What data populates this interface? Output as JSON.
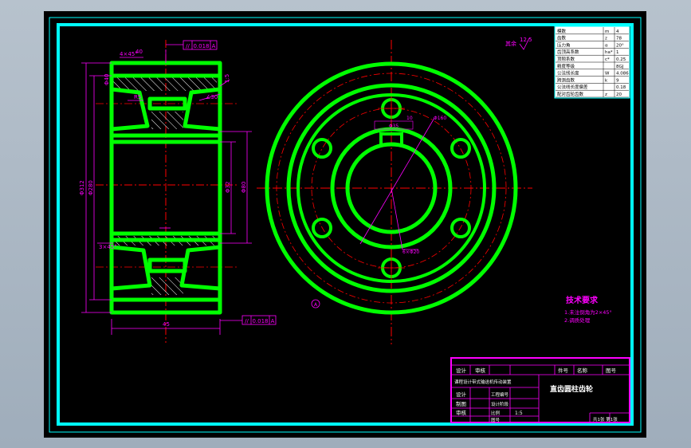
{
  "colors": {
    "background": "#000000",
    "border": "#00ffff",
    "part": "#00ff00",
    "dimension": "#ff00ff",
    "centerline": "#ff0000",
    "text": "#ffffff",
    "note": "#ff00ff"
  },
  "section_view": {
    "dims": {
      "chamfer_top": "4×45°",
      "chamfer_bottom": "3×45°",
      "outer_dia": "Φ312",
      "root_dia": "Φ280",
      "hub_dia": "Φ80",
      "bore_dia": "Φ32",
      "web_dia": "Φ40",
      "width": "45",
      "bore_width": "40",
      "fillet": "R5",
      "angle": "∠30",
      "taper": "1:5"
    },
    "tolerance_top": {
      "symbol": "//",
      "value": "0.018",
      "datum": "A"
    },
    "tolerance_bottom": {
      "symbol": "//",
      "value": "0.018",
      "datum": "A"
    }
  },
  "front_view": {
    "hole_label": "6×Φ20",
    "keyway_label": "10",
    "keyway_width": "Φ35",
    "pcd_label": "Φ160",
    "datum_label": "A",
    "roughness_note": "其余",
    "roughness_value": "12.5"
  },
  "param_table": [
    [
      "模数",
      "m",
      "4"
    ],
    [
      "齿数",
      "z",
      "78"
    ],
    [
      "压力角",
      "α",
      "20°"
    ],
    [
      "齿顶高系数",
      "ha*",
      "1"
    ],
    [
      "顶隙系数",
      "c*",
      "0.25"
    ],
    [
      "精度等级",
      "",
      "8GJ"
    ],
    [
      "公法线长度",
      "W",
      "4.086"
    ],
    [
      "跨测齿数",
      "k",
      "9"
    ],
    [
      "公法线长度偏差",
      "",
      "0.18"
    ],
    [
      "配对齿轮齿数",
      "z",
      "20"
    ]
  ],
  "technical_requirements": {
    "heading": "技术要求",
    "items": [
      "1.未注倒角为2×45°",
      "2.调质处理"
    ]
  },
  "title_block": {
    "top_row": [
      "设计",
      "审核",
      "",
      "",
      "件号",
      "名称",
      "图号"
    ],
    "project": "课程设计带式输送机传动装置",
    "drawing_title": "直齿圆柱齿轮",
    "roles": [
      "设计",
      "制图",
      "审核"
    ],
    "fields": [
      "工程编号",
      "设计阶段",
      "比例",
      "图号"
    ],
    "scale": "1:5",
    "sheet": "共1张 第1张"
  }
}
